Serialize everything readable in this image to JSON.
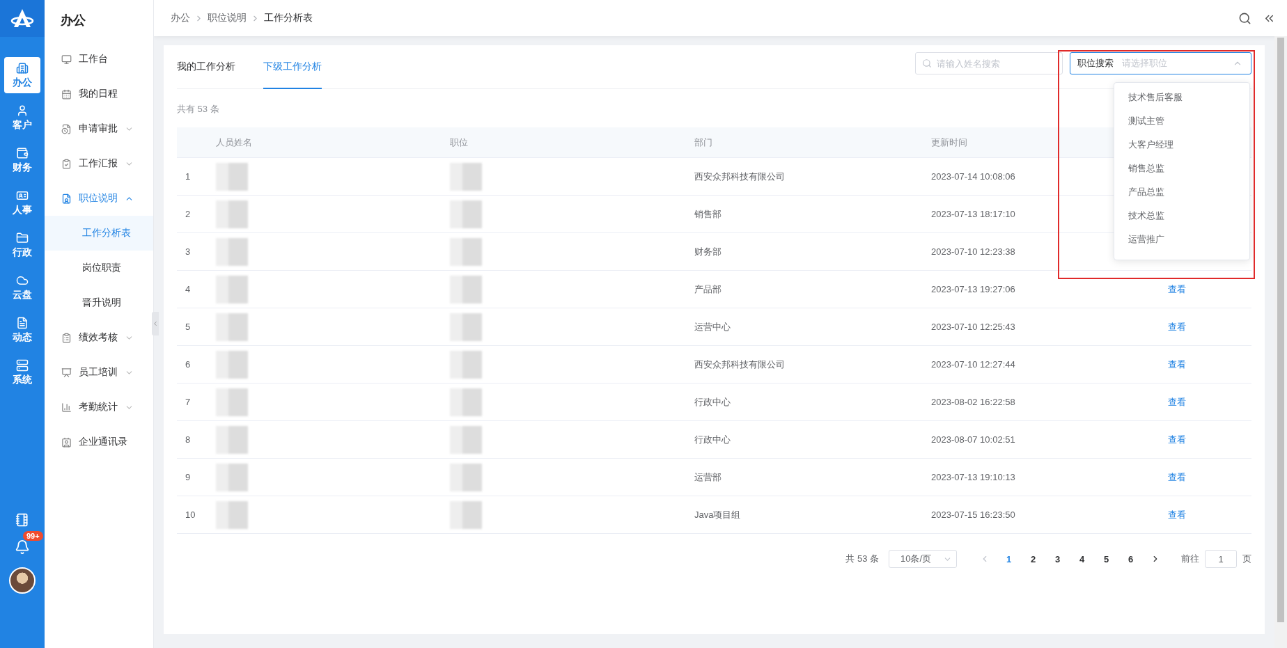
{
  "rail": {
    "items": [
      {
        "label": "办公",
        "selected": true
      },
      {
        "label": "客户",
        "selected": false
      },
      {
        "label": "财务",
        "selected": false
      },
      {
        "label": "人事",
        "selected": false
      },
      {
        "label": "行政",
        "selected": false
      },
      {
        "label": "云盘",
        "selected": false
      },
      {
        "label": "动态",
        "selected": false
      },
      {
        "label": "系统",
        "selected": false
      }
    ],
    "badge": "99+"
  },
  "sidebar": {
    "title": "办公",
    "items": [
      {
        "label": "工作台",
        "expandable": false,
        "selected": false
      },
      {
        "label": "我的日程",
        "expandable": false,
        "selected": false
      },
      {
        "label": "申请审批",
        "expandable": true,
        "expanded": false,
        "selected": false
      },
      {
        "label": "工作汇报",
        "expandable": true,
        "expanded": false,
        "selected": false
      },
      {
        "label": "职位说明",
        "expandable": true,
        "expanded": true,
        "selected": true,
        "children": [
          {
            "label": "工作分析表",
            "selected": true
          },
          {
            "label": "岗位职责",
            "selected": false
          },
          {
            "label": "晋升说明",
            "selected": false
          }
        ]
      },
      {
        "label": "绩效考核",
        "expandable": true,
        "expanded": false,
        "selected": false
      },
      {
        "label": "员工培训",
        "expandable": true,
        "expanded": false,
        "selected": false
      },
      {
        "label": "考勤统计",
        "expandable": true,
        "expanded": false,
        "selected": false
      },
      {
        "label": "企业通讯录",
        "expandable": false,
        "selected": false
      }
    ]
  },
  "breadcrumb": [
    "办公",
    "职位说明",
    "工作分析表"
  ],
  "tabs": [
    {
      "label": "我的工作分析",
      "selected": false
    },
    {
      "label": "下级工作分析",
      "selected": true
    }
  ],
  "total_text": "共有 53 条",
  "name_search": {
    "placeholder": "请输入姓名搜索"
  },
  "position_select": {
    "label": "职位搜索",
    "placeholder": "请选择职位",
    "open": true,
    "highlighted": true,
    "options": [
      "技术售后客服",
      "测试主管",
      "大客户经理",
      "销售总监",
      "产品总监",
      "技术总监",
      "运营推广"
    ]
  },
  "table": {
    "columns": [
      "人员姓名",
      "职位",
      "部门",
      "更新时间"
    ],
    "rows": [
      {
        "index": "1",
        "name_hidden": true,
        "position_hidden": true,
        "department": "西安众邦科技有限公司",
        "updated": "2023-07-14 10:08:06"
      },
      {
        "index": "2",
        "name_hidden": true,
        "position_hidden": true,
        "department": "销售部",
        "updated": "2023-07-13 18:17:10"
      },
      {
        "index": "3",
        "name_hidden": true,
        "position_hidden": true,
        "department": "财务部",
        "updated": "2023-07-10 12:23:38"
      },
      {
        "index": "4",
        "name_hidden": true,
        "position_hidden": true,
        "department": "产品部",
        "updated": "2023-07-13 19:27:06",
        "action": "查看"
      },
      {
        "index": "5",
        "name_hidden": true,
        "position_hidden": true,
        "department": "运营中心",
        "updated": "2023-07-10 12:25:43",
        "action": "查看"
      },
      {
        "index": "6",
        "name_hidden": true,
        "position_hidden": true,
        "department": "西安众邦科技有限公司",
        "updated": "2023-07-10 12:27:44",
        "action": "查看"
      },
      {
        "index": "7",
        "name_hidden": true,
        "position_hidden": true,
        "department": "行政中心",
        "updated": "2023-08-02 16:22:58",
        "action": "查看"
      },
      {
        "index": "8",
        "name_hidden": true,
        "position_hidden": true,
        "department": "行政中心",
        "updated": "2023-08-07 10:02:51",
        "action": "查看"
      },
      {
        "index": "9",
        "name_hidden": true,
        "position_hidden": true,
        "department": "运营部",
        "updated": "2023-07-13 19:10:13",
        "action": "查看"
      },
      {
        "index": "10",
        "name_hidden": true,
        "position_hidden": true,
        "department": "Java项目组",
        "updated": "2023-07-15 16:23:50",
        "action": "查看"
      }
    ]
  },
  "pagination": {
    "total": "共 53 条",
    "page_size": "10条/页",
    "pages": [
      {
        "label": "1",
        "selected": true
      },
      {
        "label": "2",
        "selected": false
      },
      {
        "label": "3",
        "selected": false
      },
      {
        "label": "4",
        "selected": false
      },
      {
        "label": "5",
        "selected": false
      },
      {
        "label": "6",
        "selected": false
      }
    ],
    "goto_label": "前往",
    "goto_value": "1",
    "goto_unit": "页"
  }
}
